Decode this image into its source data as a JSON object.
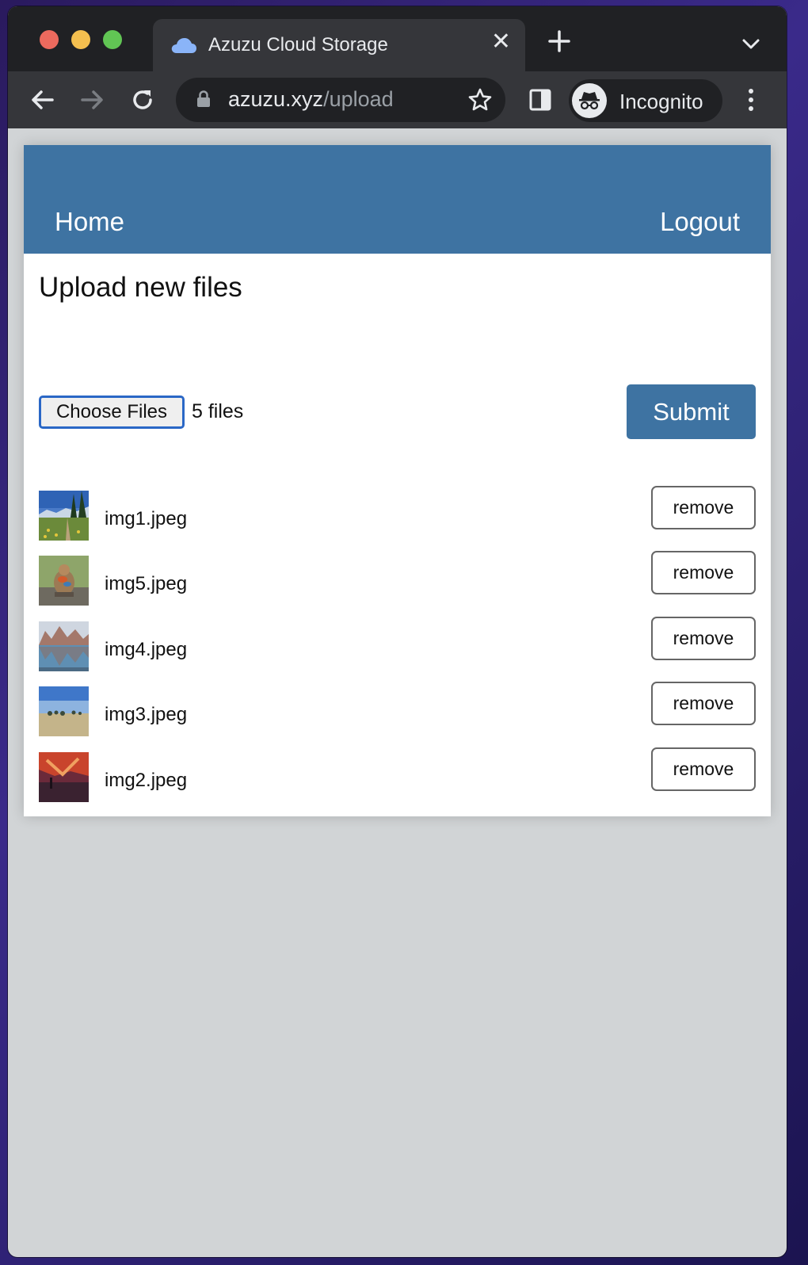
{
  "browser": {
    "tab_title": "Azuzu Cloud Storage",
    "url_host": "azuzu.xyz",
    "url_path": "/upload",
    "profile_label": "Incognito"
  },
  "nav": {
    "home": "Home",
    "logout": "Logout"
  },
  "upload": {
    "heading": "Upload new files",
    "choose_label": "Choose Files",
    "file_count": "5 files",
    "submit_label": "Submit"
  },
  "files": [
    {
      "name": "img1.jpeg",
      "remove_label": "remove",
      "thumb": "meadow-trail"
    },
    {
      "name": "img5.jpeg",
      "remove_label": "remove",
      "thumb": "marmot"
    },
    {
      "name": "img4.jpeg",
      "remove_label": "remove",
      "thumb": "mountain-lake"
    },
    {
      "name": "img3.jpeg",
      "remove_label": "remove",
      "thumb": "grassland-sky"
    },
    {
      "name": "img2.jpeg",
      "remove_label": "remove",
      "thumb": "sunset"
    }
  ],
  "colors": {
    "nav_bg": "#3e73a2",
    "submit_bg": "#3e73a2",
    "page_bg": "#d1d4d6",
    "chrome_dark": "#202124",
    "chrome_tab": "#35363a"
  }
}
